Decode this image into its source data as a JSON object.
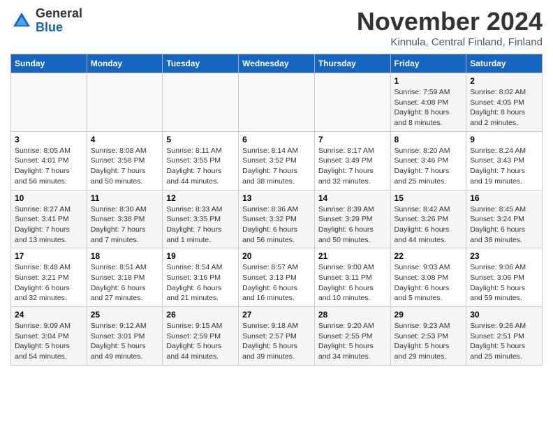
{
  "header": {
    "logo_line1": "General",
    "logo_line2": "Blue",
    "month": "November 2024",
    "location": "Kinnula, Central Finland, Finland"
  },
  "weekdays": [
    "Sunday",
    "Monday",
    "Tuesday",
    "Wednesday",
    "Thursday",
    "Friday",
    "Saturday"
  ],
  "weeks": [
    [
      {
        "day": "",
        "info": ""
      },
      {
        "day": "",
        "info": ""
      },
      {
        "day": "",
        "info": ""
      },
      {
        "day": "",
        "info": ""
      },
      {
        "day": "",
        "info": ""
      },
      {
        "day": "1",
        "info": "Sunrise: 7:59 AM\nSunset: 4:08 PM\nDaylight: 8 hours and 8 minutes."
      },
      {
        "day": "2",
        "info": "Sunrise: 8:02 AM\nSunset: 4:05 PM\nDaylight: 8 hours and 2 minutes."
      }
    ],
    [
      {
        "day": "3",
        "info": "Sunrise: 8:05 AM\nSunset: 4:01 PM\nDaylight: 7 hours and 56 minutes."
      },
      {
        "day": "4",
        "info": "Sunrise: 8:08 AM\nSunset: 3:58 PM\nDaylight: 7 hours and 50 minutes."
      },
      {
        "day": "5",
        "info": "Sunrise: 8:11 AM\nSunset: 3:55 PM\nDaylight: 7 hours and 44 minutes."
      },
      {
        "day": "6",
        "info": "Sunrise: 8:14 AM\nSunset: 3:52 PM\nDaylight: 7 hours and 38 minutes."
      },
      {
        "day": "7",
        "info": "Sunrise: 8:17 AM\nSunset: 3:49 PM\nDaylight: 7 hours and 32 minutes."
      },
      {
        "day": "8",
        "info": "Sunrise: 8:20 AM\nSunset: 3:46 PM\nDaylight: 7 hours and 25 minutes."
      },
      {
        "day": "9",
        "info": "Sunrise: 8:24 AM\nSunset: 3:43 PM\nDaylight: 7 hours and 19 minutes."
      }
    ],
    [
      {
        "day": "10",
        "info": "Sunrise: 8:27 AM\nSunset: 3:41 PM\nDaylight: 7 hours and 13 minutes."
      },
      {
        "day": "11",
        "info": "Sunrise: 8:30 AM\nSunset: 3:38 PM\nDaylight: 7 hours and 7 minutes."
      },
      {
        "day": "12",
        "info": "Sunrise: 8:33 AM\nSunset: 3:35 PM\nDaylight: 7 hours and 1 minute."
      },
      {
        "day": "13",
        "info": "Sunrise: 8:36 AM\nSunset: 3:32 PM\nDaylight: 6 hours and 56 minutes."
      },
      {
        "day": "14",
        "info": "Sunrise: 8:39 AM\nSunset: 3:29 PM\nDaylight: 6 hours and 50 minutes."
      },
      {
        "day": "15",
        "info": "Sunrise: 8:42 AM\nSunset: 3:26 PM\nDaylight: 6 hours and 44 minutes."
      },
      {
        "day": "16",
        "info": "Sunrise: 8:45 AM\nSunset: 3:24 PM\nDaylight: 6 hours and 38 minutes."
      }
    ],
    [
      {
        "day": "17",
        "info": "Sunrise: 8:48 AM\nSunset: 3:21 PM\nDaylight: 6 hours and 32 minutes."
      },
      {
        "day": "18",
        "info": "Sunrise: 8:51 AM\nSunset: 3:18 PM\nDaylight: 6 hours and 27 minutes."
      },
      {
        "day": "19",
        "info": "Sunrise: 8:54 AM\nSunset: 3:16 PM\nDaylight: 6 hours and 21 minutes."
      },
      {
        "day": "20",
        "info": "Sunrise: 8:57 AM\nSunset: 3:13 PM\nDaylight: 6 hours and 16 minutes."
      },
      {
        "day": "21",
        "info": "Sunrise: 9:00 AM\nSunset: 3:11 PM\nDaylight: 6 hours and 10 minutes."
      },
      {
        "day": "22",
        "info": "Sunrise: 9:03 AM\nSunset: 3:08 PM\nDaylight: 6 hours and 5 minutes."
      },
      {
        "day": "23",
        "info": "Sunrise: 9:06 AM\nSunset: 3:06 PM\nDaylight: 5 hours and 59 minutes."
      }
    ],
    [
      {
        "day": "24",
        "info": "Sunrise: 9:09 AM\nSunset: 3:04 PM\nDaylight: 5 hours and 54 minutes."
      },
      {
        "day": "25",
        "info": "Sunrise: 9:12 AM\nSunset: 3:01 PM\nDaylight: 5 hours and 49 minutes."
      },
      {
        "day": "26",
        "info": "Sunrise: 9:15 AM\nSunset: 2:59 PM\nDaylight: 5 hours and 44 minutes."
      },
      {
        "day": "27",
        "info": "Sunrise: 9:18 AM\nSunset: 2:57 PM\nDaylight: 5 hours and 39 minutes."
      },
      {
        "day": "28",
        "info": "Sunrise: 9:20 AM\nSunset: 2:55 PM\nDaylight: 5 hours and 34 minutes."
      },
      {
        "day": "29",
        "info": "Sunrise: 9:23 AM\nSunset: 2:53 PM\nDaylight: 5 hours and 29 minutes."
      },
      {
        "day": "30",
        "info": "Sunrise: 9:26 AM\nSunset: 2:51 PM\nDaylight: 5 hours and 25 minutes."
      }
    ]
  ]
}
